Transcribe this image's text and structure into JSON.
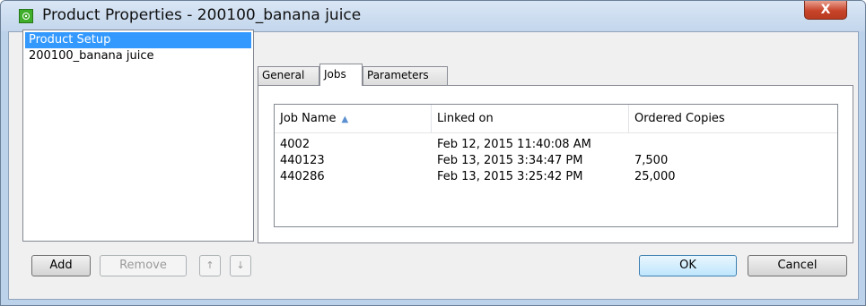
{
  "window": {
    "title": "Product Properties - 200100_banana juice",
    "close_label": "X",
    "app_icon": "product-icon"
  },
  "list": {
    "items": [
      {
        "label": "Product Setup",
        "selected": true
      },
      {
        "label": "200100_banana juice",
        "selected": false
      }
    ]
  },
  "list_buttons": {
    "add": "Add",
    "remove": "Remove",
    "up": "↑",
    "down": "↓"
  },
  "tabs": [
    {
      "label": "General",
      "active": false
    },
    {
      "label": "Jobs",
      "active": true
    },
    {
      "label": "Parameters",
      "active": false
    }
  ],
  "jobs_table": {
    "headers": [
      "Job Name",
      "Linked on",
      "Ordered Copies"
    ],
    "sort_indicator": "▲",
    "rows": [
      {
        "job": "4002",
        "linked": "Feb 12, 2015 11:40:08 AM",
        "copies": ""
      },
      {
        "job": "440123",
        "linked": "Feb 13, 2015 3:34:47 PM",
        "copies": "7,500"
      },
      {
        "job": "440286",
        "linked": "Feb 13, 2015 3:25:42 PM",
        "copies": "25,000"
      }
    ]
  },
  "dialog_buttons": {
    "ok": "OK",
    "cancel": "Cancel"
  }
}
